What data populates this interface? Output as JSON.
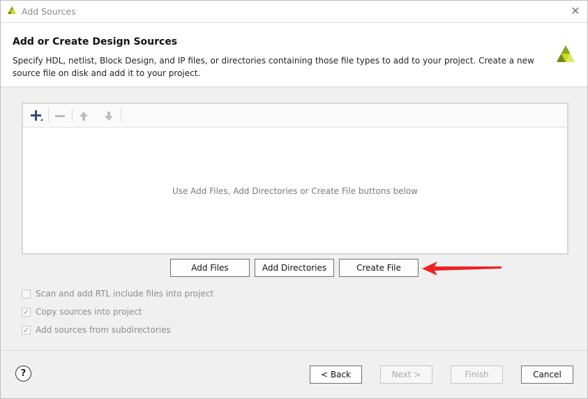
{
  "window": {
    "title": "Add Sources",
    "close_glyph": "✕"
  },
  "header": {
    "title": "Add or Create Design Sources",
    "description": "Specify HDL, netlist, Block Design, and IP files, or directories containing those file types to add to your project. Create a new source file on disk and add it to your project."
  },
  "toolbar": {
    "add_icon": "plus-icon",
    "remove_icon": "minus-icon",
    "up_icon": "arrow-up-icon",
    "down_icon": "arrow-down-icon"
  },
  "file_list": {
    "empty_message": "Use Add Files, Add Directories or Create File buttons below"
  },
  "actions": {
    "add_files": "Add Files",
    "add_directories": "Add Directories",
    "create_file": "Create File"
  },
  "options": [
    {
      "label": "Scan and add RTL include files into project",
      "checked": false
    },
    {
      "label": "Copy sources into project",
      "checked": true
    },
    {
      "label": "Add sources from subdirectories",
      "checked": true
    }
  ],
  "footer": {
    "help": "?",
    "back": "< Back",
    "next": "Next >",
    "finish": "Finish",
    "cancel": "Cancel"
  },
  "colors": {
    "accent_blue": "#2b5797",
    "arrow_red": "#ee2222",
    "logo_green": "#8aa81e",
    "logo_lime": "#c7dc2a"
  }
}
